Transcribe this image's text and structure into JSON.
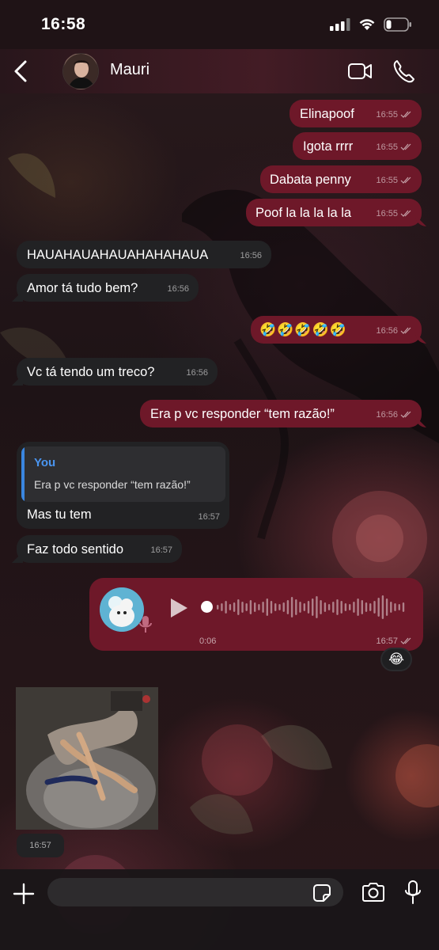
{
  "status_bar": {
    "time": "16:58"
  },
  "header": {
    "contact_name": "Mauri"
  },
  "messages": [
    {
      "dir": "out",
      "text": "Elinapoof",
      "time": "16:55"
    },
    {
      "dir": "out",
      "text": "Igota rrrr",
      "time": "16:55"
    },
    {
      "dir": "out",
      "text": "Dabata penny",
      "time": "16:55"
    },
    {
      "dir": "out",
      "text": "Poof la la la la la",
      "time": "16:55"
    },
    {
      "dir": "in",
      "text": "HAUAHAUAHAUAHAHAHAUA",
      "time": "16:56"
    },
    {
      "dir": "in",
      "text": "Amor tá tudo bem?",
      "time": "16:56"
    },
    {
      "dir": "out",
      "text": "🤣🤣🤣🤣🤣",
      "time": "16:56"
    },
    {
      "dir": "in",
      "text": "Vc tá tendo um treco?",
      "time": "16:56"
    },
    {
      "dir": "out",
      "text": "Era p vc responder “tem razão!”",
      "time": "16:56"
    },
    {
      "dir": "in",
      "text": "Mas tu tem",
      "time": "16:57",
      "reply": {
        "author": "You",
        "text": "Era p vc responder “tem razão!”"
      }
    },
    {
      "dir": "in",
      "text": "Faz todo sentido",
      "time": "16:57"
    }
  ],
  "voice_note": {
    "duration": "0:06",
    "time": "16:57",
    "reaction": "😂"
  },
  "media_message": {
    "time": "16:57"
  },
  "composer": {
    "placeholder": ""
  },
  "colors": {
    "outgoing_bubble": "#6e1829",
    "incoming_bubble": "#222224",
    "reply_accent": "#3a86e0"
  }
}
